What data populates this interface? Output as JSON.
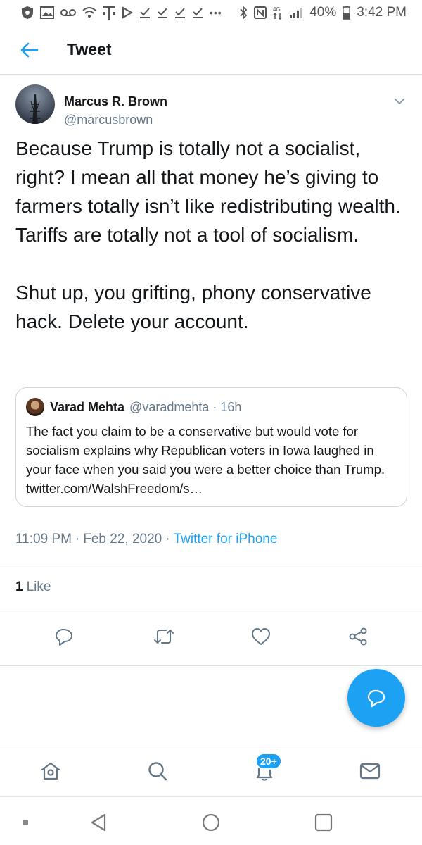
{
  "status_bar": {
    "battery": "40%",
    "time": "3:42 PM",
    "network": "4G",
    "overflow_dots": "•••"
  },
  "header": {
    "title": "Tweet",
    "back_icon": "arrow-left-icon"
  },
  "tweet": {
    "author_name": "Marcus R. Brown",
    "author_handle": "@marcusbrown",
    "text_paragraphs": [
      "Because Trump is totally not a socialist, right? I mean all that money he’s giving to farmers totally isn’t like redistributing wealth. Tariffs are totally not a tool of socialism.",
      "Shut up, you grifting, phony conservative hack. Delete your account."
    ],
    "quoted": {
      "author_name": "Varad Mehta",
      "author_handle": "@varadmehta",
      "separator": "·",
      "time_ago": "16h",
      "text": "The fact you claim to be a conservative but would vote for socialism explains why Republican voters in Iowa laughed in your face when you said you were a better choice than Trump. twitter.com/WalshFreedom/s…"
    },
    "time": "11:09 PM",
    "separator": "·",
    "date": "Feb 22, 2020",
    "source": "Twitter for iPhone",
    "likes_count": "1",
    "likes_label": "Like"
  },
  "actions": [
    "reply-icon",
    "retweet-icon",
    "like-icon",
    "share-icon"
  ],
  "bottom_nav": {
    "items": [
      "home-icon",
      "search-icon",
      "notifications-icon",
      "messages-icon"
    ],
    "notifications_badge": "20+"
  },
  "colors": {
    "accent": "#1da1f2",
    "text_primary": "#14171a",
    "text_secondary": "#657786",
    "border": "#dfe3e6"
  }
}
